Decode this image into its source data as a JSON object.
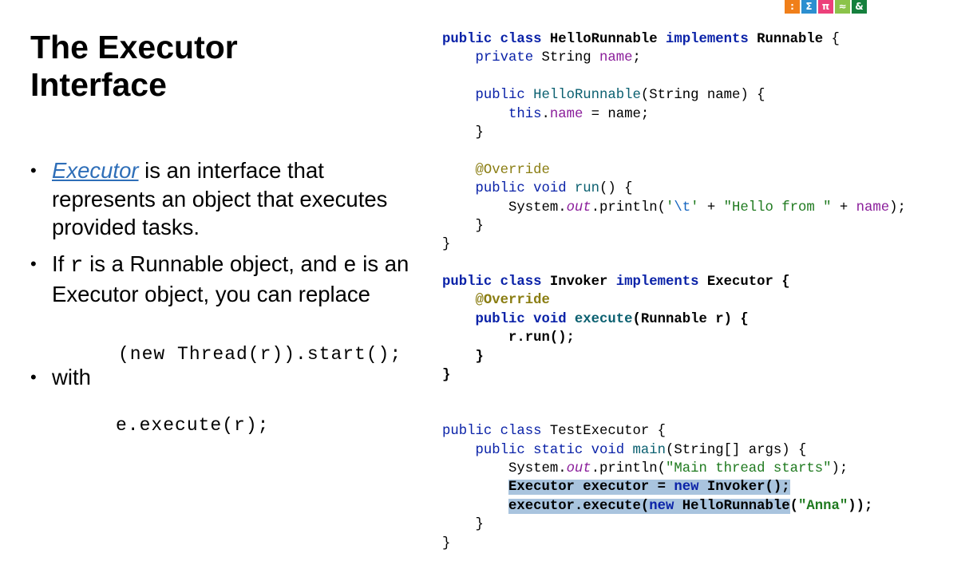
{
  "logo": [
    {
      "char": ":",
      "color": "#f07f1a"
    },
    {
      "char": "Σ",
      "color": "#2c8fd0"
    },
    {
      "char": "π",
      "color": "#ec407a"
    },
    {
      "char": "≈",
      "color": "#8bc34a"
    },
    {
      "char": "&",
      "color": "#15803d"
    }
  ],
  "slide": {
    "title_line1": "The Executor",
    "title_line2": "Interface",
    "bullet1_link": "Executor",
    "bullet1_text": " is an interface that represents an object that executes provided tasks.",
    "bullet2_a": "If ",
    "bullet2_r": "r",
    "bullet2_b": " is a Runnable object, and ",
    "bullet2_e": "e",
    "bullet2_c": " is an Executor object, you can replace",
    "snippet1": "(new Thread(r)).start();",
    "bullet3": "with",
    "snippet2": "e.execute(r);"
  },
  "code": {
    "hr": {
      "l1_kw": "public class",
      "l1_name": " HelloRunnable ",
      "l1_impl": "implements",
      "l1_if": " Runnable ",
      "l1_brace": "{",
      "l2_kw": "private",
      "l2_type": " String ",
      "l2_field": "name",
      "l2_semi": ";",
      "l4_kw": "public",
      "l4_ctor": " HelloRunnable",
      "l4_rest": "(String name) {",
      "l5_this": "this",
      "l5_dot": ".",
      "l5_field": "name",
      "l5_rest": " = name;",
      "l6": "}",
      "l8_ann": "@Override",
      "l9_kw": "public void",
      "l9_method": " run",
      "l9_rest": "() {",
      "l10_a": "System.",
      "l10_out": "out",
      "l10_b": ".println(",
      "l10_c1": "'",
      "l10_esc": "\\t",
      "l10_c2": "'",
      "l10_plus1": " + ",
      "l10_str": "\"Hello from \"",
      "l10_plus2": " + ",
      "l10_field": "name",
      "l10_end": ");",
      "l11": "}",
      "l12": "}"
    },
    "inv": {
      "l1_kw": "public class",
      "l1_name": " Invoker ",
      "l1_impl": "implements",
      "l1_if": " Executor {",
      "l2_ann": "@Override",
      "l3_kw": "public void",
      "l3_method": " execute",
      "l3_rest": "(Runnable r) {",
      "l4": "r.run();",
      "l5": "}",
      "l6": "}"
    },
    "te": {
      "l1_kw": "public class",
      "l1_rest": " TestExecutor {",
      "l2_kw": "public static void",
      "l2_method": " main",
      "l2_rest": "(String[] args) {",
      "l3_a": "System.",
      "l3_out": "out",
      "l3_b": ".println(",
      "l3_str": "\"Main thread starts\"",
      "l3_end": ");",
      "l4_a": "Executor executor = ",
      "l4_new": "new",
      "l4_b": " Invoker();",
      "l5_a": "executor.execute(",
      "l5_new": "new",
      "l5_b": " HelloRunnable",
      "l5_c": "(",
      "l5_str": "\"Anna\"",
      "l5_end": "));",
      "l6": "}",
      "l7": "}"
    }
  }
}
